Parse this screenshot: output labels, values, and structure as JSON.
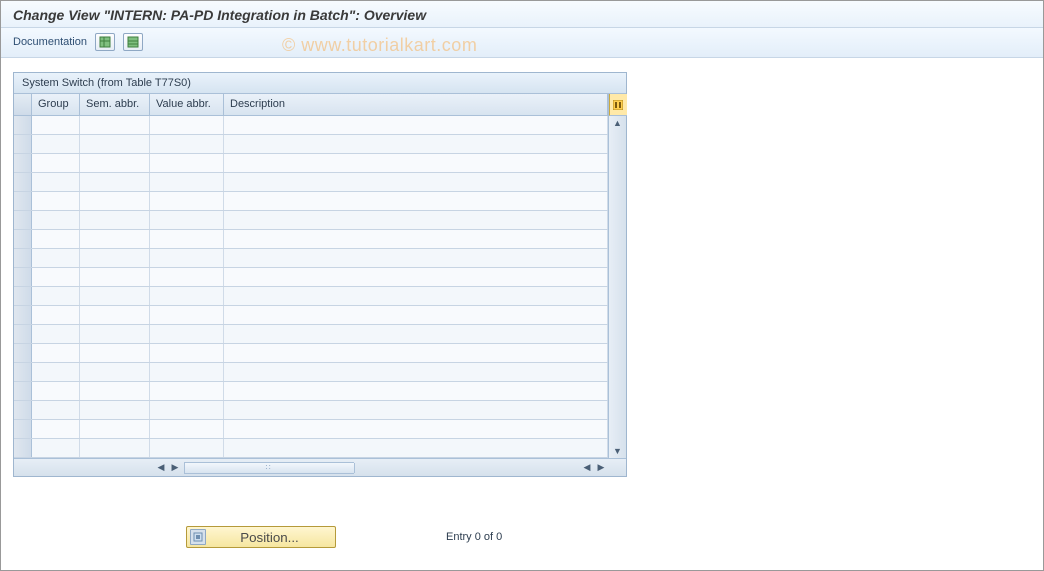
{
  "page_title": "Change View \"INTERN: PA-PD Integration in Batch\": Overview",
  "toolbar": {
    "documentation_label": "Documentation",
    "icon1_name": "table-view-icon",
    "icon2_name": "table-settings-icon"
  },
  "watermark": "© www.tutorialkart.com",
  "panel": {
    "title": "System Switch (from Table T77S0)",
    "columns": {
      "group": "Group",
      "sem_abbr": "Sem. abbr.",
      "value_abbr": "Value abbr.",
      "description": "Description"
    },
    "config_icon_name": "configure-columns-icon",
    "row_count": 18,
    "rows": []
  },
  "footer": {
    "position_button_label": "Position...",
    "entry_text": "Entry 0 of 0"
  }
}
